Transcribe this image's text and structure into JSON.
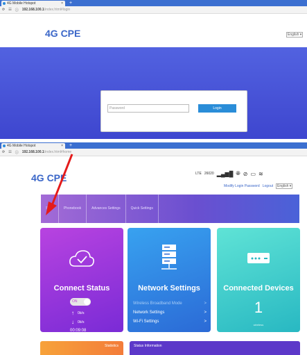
{
  "browser1": {
    "tab_title": "4G Mobile Hotspot",
    "tab_close": "×",
    "new_tab": "+",
    "url_host": "192.168.100.1",
    "url_path": "/index.html#login"
  },
  "login_page": {
    "logo": "4G CPE",
    "language": "English",
    "password_placeholder": "Password",
    "login_button": "Login"
  },
  "browser2": {
    "tab_title": "4G Mobile Hotspot",
    "tab_close": "×",
    "new_tab": "+",
    "url_host": "192.168.100.1",
    "url_path": "/index.html#home"
  },
  "home_page": {
    "logo": "4G CPE",
    "status": {
      "network_type": "LTE",
      "operator_code": "26020",
      "data_icon_label": "1↓",
      "colors": {
        "accent": "#3a66c8"
      }
    },
    "links": {
      "modify_password": "Modify Login Password",
      "logout": "Logout",
      "language": "English"
    },
    "menu": [
      "SMS",
      "Phonebook",
      "Advances Settings",
      "Quick Settings"
    ],
    "cards": {
      "connect": {
        "title": "Connect Status",
        "toggle_label": "ON",
        "upload": "0b/s",
        "download": "0b/s",
        "time": "00:09:08"
      },
      "network": {
        "title": "Network Settings",
        "items": [
          "Wireless Broadband Mode",
          "Network Settings",
          "Wi-Fi Settings"
        ],
        "chevron": ">"
      },
      "devices": {
        "title": "Connected Devices",
        "count": "1",
        "sublabel": "wireless"
      }
    },
    "bottom": {
      "statistics": "Statistics",
      "status_information": "Status Information"
    }
  }
}
